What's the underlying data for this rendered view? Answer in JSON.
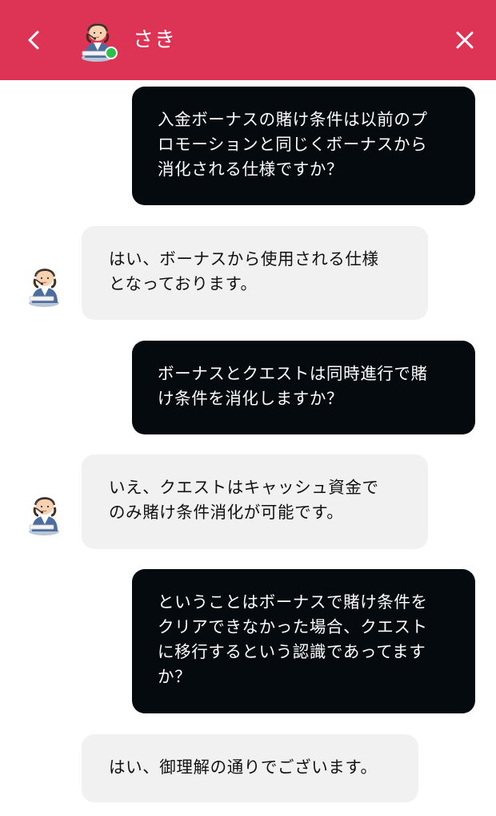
{
  "header": {
    "agent_name": "さき",
    "back_icon": "chevron-left-icon",
    "close_icon": "close-icon",
    "status_color": "#2fbf4f",
    "background_color": "#dd3355"
  },
  "messages": [
    {
      "sender": "user",
      "text": "入金ボーナスの賭け条件は以前のプ\nロモーションと同じくボーナスから\n消化される仕様ですか？"
    },
    {
      "sender": "agent",
      "text": "はい、ボーナスから使用される仕様\nとなっております。"
    },
    {
      "sender": "user",
      "text": "ボーナスとクエストは同時進行で賭\nけ条件を消化しますか？"
    },
    {
      "sender": "agent",
      "text": "いえ、クエストはキャッシュ資金で\nのみ賭け条件消化が可能です。"
    },
    {
      "sender": "user",
      "text": "ということはボーナスで賭け条件を\nクリアできなかった場合、クエスト\nに移行するという認識であってます\nか？"
    },
    {
      "sender": "agent",
      "text": "はい、御理解の通りでございます。"
    }
  ]
}
